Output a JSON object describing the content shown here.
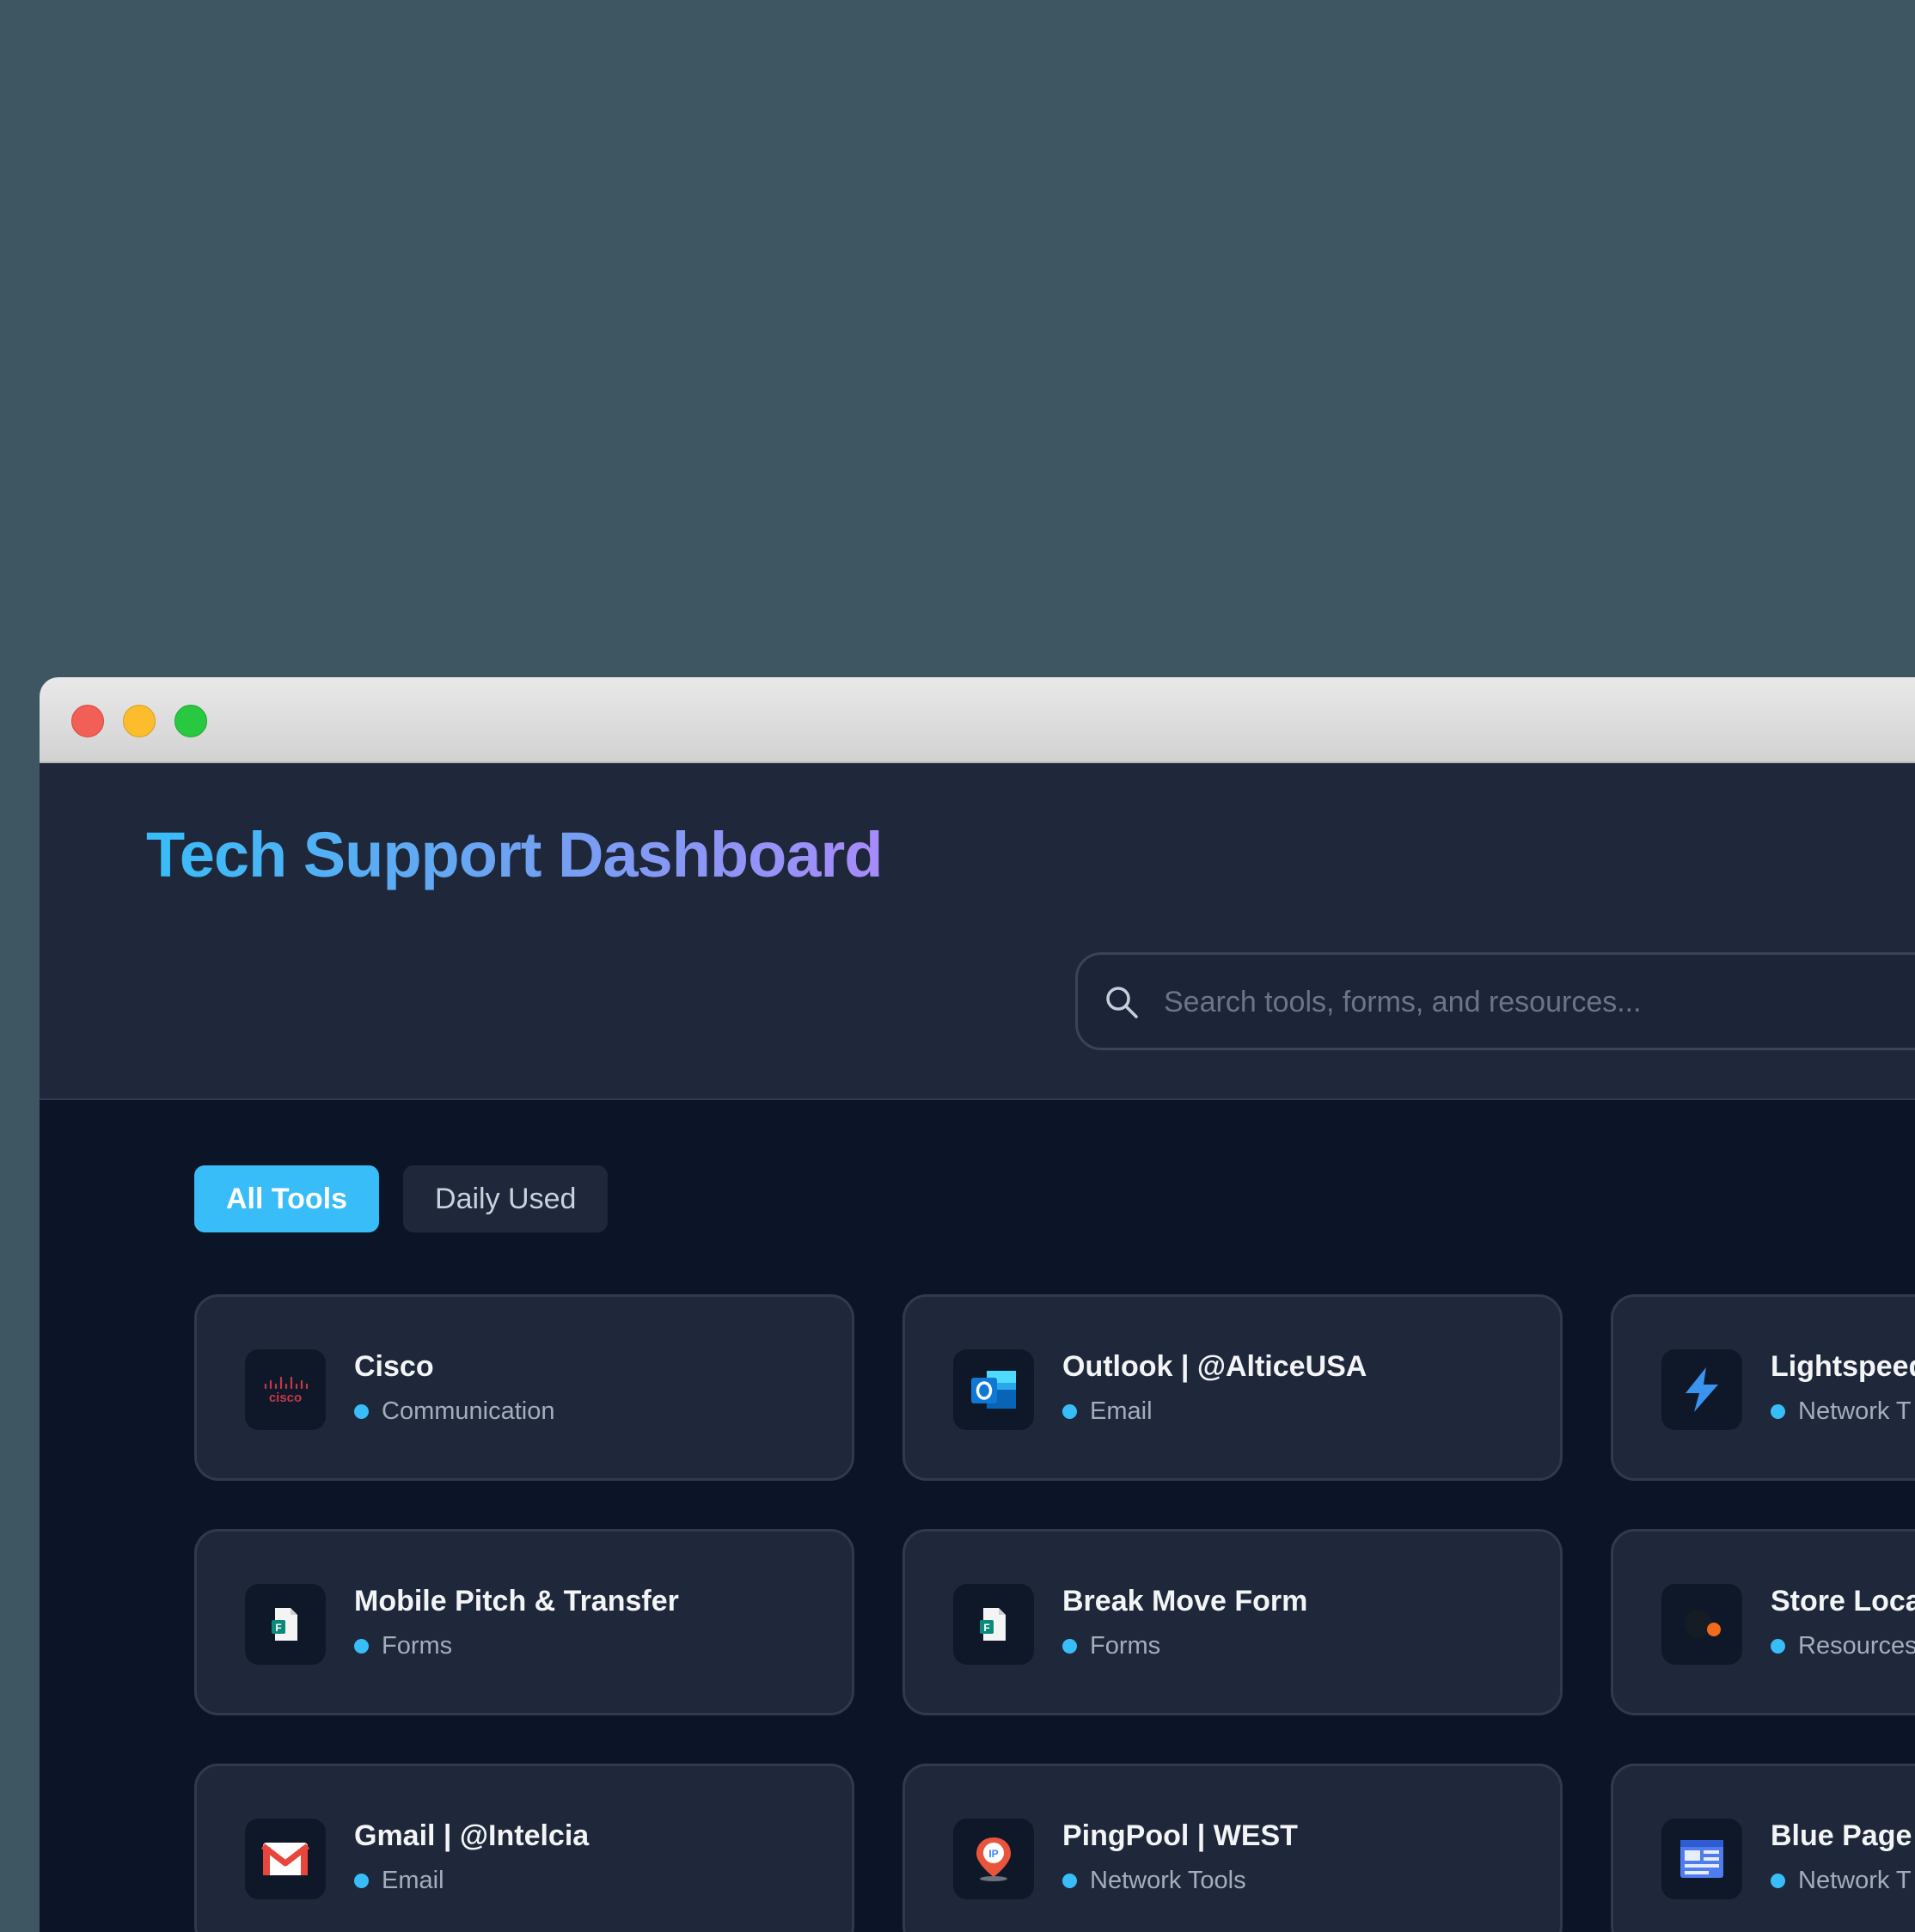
{
  "window": {
    "controls": [
      "close",
      "minimize",
      "maximize"
    ]
  },
  "header": {
    "title": "Tech Support Dashboard",
    "search": {
      "placeholder": "Search tools, forms, and resources...",
      "value": ""
    }
  },
  "tabs": [
    {
      "label": "All Tools",
      "active": true
    },
    {
      "label": "Daily Used",
      "active": false
    }
  ],
  "colors": {
    "accent": "#38bdf8",
    "title_gradient": [
      "#38bdf8",
      "#a78bfa"
    ],
    "header_bg": "#1e283a",
    "body_bg": "#0c1527",
    "card_bg": "#1e283a"
  },
  "tools": [
    {
      "name": "Cisco",
      "category": "Communication",
      "icon": "cisco-logo-icon"
    },
    {
      "name": "Outlook | @AlticeUSA",
      "category": "Email",
      "icon": "outlook-icon"
    },
    {
      "name": "Lightspeed",
      "category": "Network T",
      "icon": "lightning-bolt-icon"
    },
    {
      "name": "Mobile Pitch & Transfer",
      "category": "Forms",
      "icon": "forms-document-icon"
    },
    {
      "name": "Break Move Form",
      "category": "Forms",
      "icon": "forms-document-icon"
    },
    {
      "name": "Store Loca",
      "category": "Resources",
      "icon": "store-locator-icon"
    },
    {
      "name": "Gmail | @Intelcia",
      "category": "Email",
      "icon": "gmail-icon"
    },
    {
      "name": "PingPool | WEST",
      "category": "Network Tools",
      "icon": "ip-location-pin-icon"
    },
    {
      "name": "Blue Page",
      "category": "Network T",
      "icon": "blue-page-icon"
    }
  ]
}
